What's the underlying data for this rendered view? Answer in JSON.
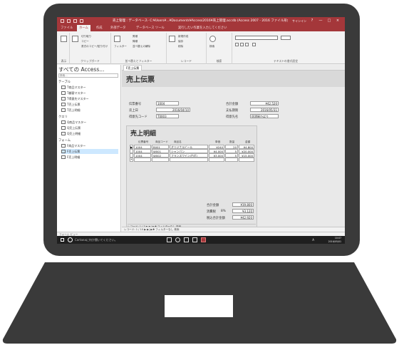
{
  "window": {
    "title": "売上管理 : データベース- C:¥Users¥...¥Documents¥Access2016¥売上管理.accdb (Access 2007 - 2016 ファイル形式) - Access",
    "signin": "サインイン",
    "controls": [
      "?",
      "—",
      "□",
      "×"
    ]
  },
  "ribbon": {
    "tabs": [
      "ファイル",
      "ホーム",
      "作成",
      "外部データ",
      "データベース ツール"
    ],
    "active_tab": "ホーム",
    "tell_me": "実行したい作業を入力してください",
    "groups": [
      {
        "label": "表示",
        "lines": [
          "表示"
        ]
      },
      {
        "label": "クリップボード",
        "lines": [
          "切り取り",
          "コピー",
          "書式のコピー/貼り付け"
        ]
      },
      {
        "label": "並べ替えとフィルター",
        "lines": [
          "フィルター",
          "昇順",
          "降順",
          "並べ替えの解除"
        ]
      },
      {
        "label": "レコード",
        "lines": [
          "新規作成",
          "保存",
          "削除"
        ]
      },
      {
        "label": "検索",
        "lines": [
          "検索"
        ]
      },
      {
        "label": "テキストの書式設定",
        "lines": []
      }
    ]
  },
  "nav": {
    "title": "すべての Access...",
    "search_placeholder": "検索...",
    "groups": [
      {
        "label": "テーブル",
        "items": [
          "T商品マスター",
          "T顧客マスター",
          "T得意先マスター",
          "T売上伝票",
          "T売上明細"
        ]
      },
      {
        "label": "クエリ",
        "items": [
          "Q商品マスター",
          "Q売上伝票",
          "Q売上明細"
        ]
      },
      {
        "label": "フォーム",
        "items": [
          "F商品マスター",
          "F売上伝票",
          "F売上明細"
        ]
      }
    ],
    "selected_item": "F売上伝票"
  },
  "document": {
    "tab_label": "F売上伝票",
    "form_title": "売上伝票",
    "fields": [
      {
        "label": "伝票番号",
        "value": "1004"
      },
      {
        "label": "売上日",
        "value": "2016/04/10"
      },
      {
        "label": "得意先コード",
        "value": "T0003"
      },
      {
        "label": "合計金額",
        "value": "¥42,520"
      },
      {
        "label": "支払期限",
        "value": "2016/05/31"
      },
      {
        "label": "得意先名",
        "value": "居酒屋ひばり"
      }
    ],
    "subform": {
      "title": "売上明細",
      "columns": [
        "伝票番号",
        "商品コード",
        "商品名",
        "単価",
        "数量",
        "金額"
      ],
      "rows": [
        [
          "1004",
          "B001",
          "オリジナルビール",
          "¥240",
          "20",
          "¥4,800"
        ],
        [
          "1004",
          "W001",
          "シャンパン",
          "¥4,000",
          "5",
          "¥20,000"
        ],
        [
          "1004",
          "W002",
          "フランスワイン(白ボ)",
          "¥3,000",
          "5",
          "¥15,000"
        ]
      ],
      "new_row_marker": "*",
      "current_row_marker": "▶",
      "record_nav": "レコード: 1 / 3 ▶ ▶| ▶✱ フィルターなし 検索"
    },
    "totals": [
      {
        "label": "合計金額",
        "rate": "",
        "value": "¥39,800"
      },
      {
        "label": "消費税",
        "rate": "8%",
        "value": "¥3,120"
      },
      {
        "label": "税込合計金額",
        "rate": "",
        "value": "¥42,920"
      }
    ],
    "record_nav": "レコード: 1 / 10 ▶ ▶| ▶✱ フィルターなし 検索"
  },
  "statusbar": {
    "text": "フォーム ビュー"
  },
  "taskbar": {
    "search_text": "Cortanaに何か聞いてください。",
    "time": "10:07",
    "date": "2016/05/01",
    "ime": "A"
  },
  "colors": {
    "access_brand": "#a4373a",
    "laptop_body": "#3a3a3a"
  }
}
